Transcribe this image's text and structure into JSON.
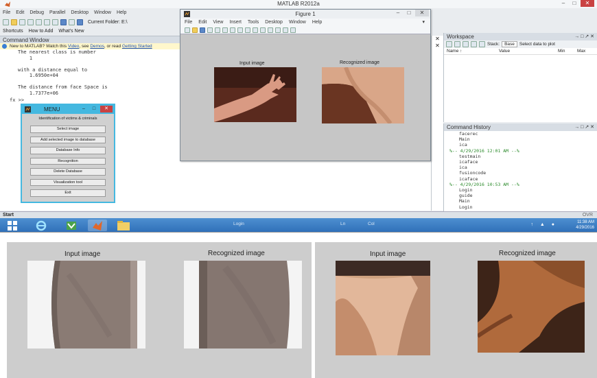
{
  "matlab": {
    "title": "MATLAB R2012a",
    "menu": [
      "File",
      "Edit",
      "Debug",
      "Parallel",
      "Desktop",
      "Window",
      "Help"
    ],
    "current_folder_label": "Current Folder: E:\\",
    "shortcuts": [
      "Shortcuts",
      "How to Add",
      "What's New"
    ],
    "command_window": {
      "title": "Command Window",
      "notice_prefix": "New to MATLAB? Watch this",
      "notice_link1": "Video",
      "notice_mid": ", see",
      "notice_link2": "Demos",
      "notice_mid2": ", or read",
      "notice_link3": "Getting Started",
      "output": "The nearest class is number\n    1\n\nwith a distance equal to\n    1.6950e+04\n\nThe distance from face Space is\n    1.7377e+06",
      "prompt": "fx >>"
    },
    "workspace": {
      "title": "Workspace",
      "stack_label": "Stack:",
      "stack_value": "Base",
      "select_data_label": "Select data to plot",
      "columns": [
        "Name ↑",
        "Value",
        "Min",
        "Max"
      ]
    },
    "command_history": {
      "title": "Command History",
      "items": [
        {
          "text": "facerec",
          "sep": false
        },
        {
          "text": "Main",
          "sep": false
        },
        {
          "text": "ica",
          "sep": false
        },
        {
          "text": "%-- 4/29/2016 12:01 AM --%",
          "sep": true
        },
        {
          "text": "testmain",
          "sep": false
        },
        {
          "text": "icaface",
          "sep": false
        },
        {
          "text": "ica",
          "sep": false
        },
        {
          "text": "fusioncode",
          "sep": false
        },
        {
          "text": "icaface",
          "sep": false
        },
        {
          "text": "%-- 4/29/2016 10:53 AM --%",
          "sep": true
        },
        {
          "text": "Login",
          "sep": false
        },
        {
          "text": "guide",
          "sep": false
        },
        {
          "text": "Main",
          "sep": false
        },
        {
          "text": "Login",
          "sep": false
        }
      ]
    },
    "start_label": "Start",
    "ovr_label": "OVR"
  },
  "figure": {
    "title": "Figure 1",
    "menu": [
      "File",
      "Edit",
      "View",
      "Insert",
      "Tools",
      "Desktop",
      "Window",
      "Help"
    ],
    "input_label": "Input image",
    "recognized_label": "Recognized image"
  },
  "menu_dialog": {
    "title": "MENU",
    "heading": "Identification of victims & criminals",
    "buttons": [
      "Select image",
      "Add selected image to database",
      "Database Info",
      "Recognition",
      "Delete Database",
      "Visualization tool",
      "Exit"
    ]
  },
  "taskbar": {
    "status_text": "Login",
    "ln_label": "Ln",
    "col_label": "Col",
    "clock_time": "11:38 AM",
    "clock_date": "4/29/2016"
  },
  "panels": {
    "left": {
      "input_label": "Input image",
      "recognized_label": "Recognized image"
    },
    "right": {
      "input_label": "Input image",
      "recognized_label": "Recognized image"
    }
  },
  "colors": {
    "dialog_accent": "#44b8e0",
    "taskbar": "#2f6fb8",
    "history_separator": "#2a8a2a",
    "close_button": "#c94242"
  }
}
